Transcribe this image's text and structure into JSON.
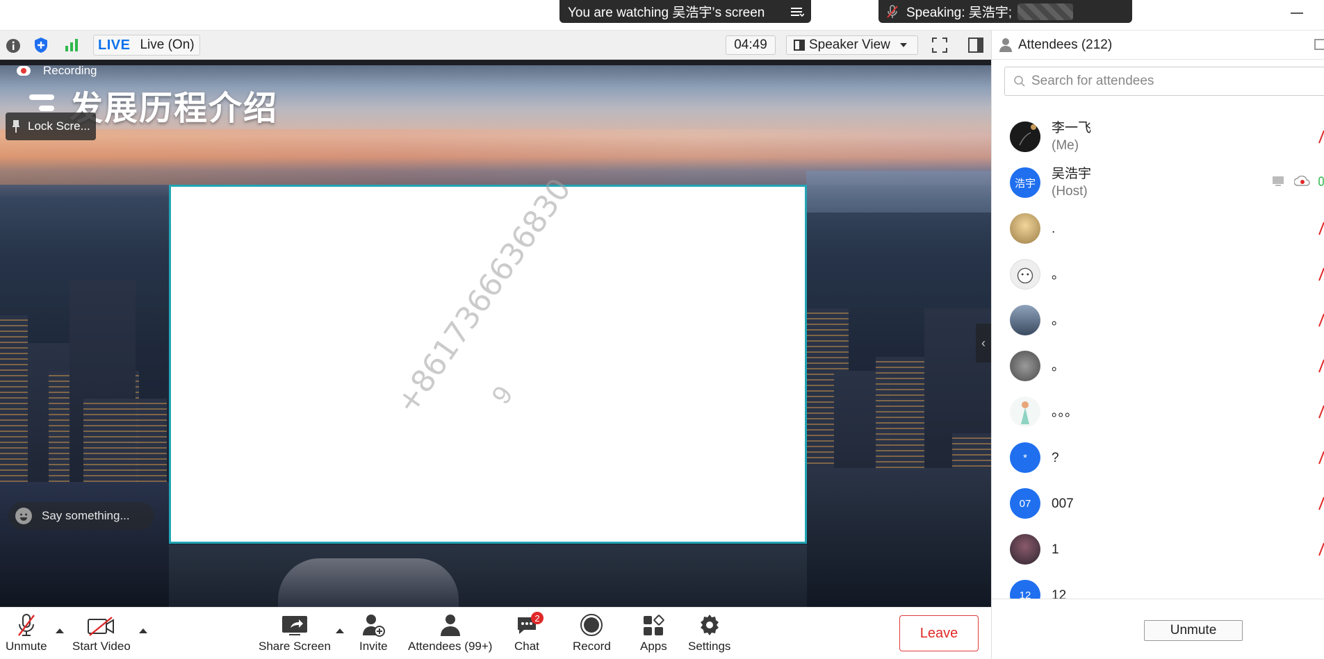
{
  "top": {
    "watching_text": "You are watching 吴浩宇’s screen",
    "speaking_text": "Speaking: 吴浩宇;"
  },
  "meeting": {
    "live_badge": "LIVE",
    "live_status": "Live (On)",
    "timer": "04:49",
    "view_mode": "Speaker View"
  },
  "stage": {
    "recording_label": "Recording",
    "headline": "发展历程介绍",
    "lock_screen_label": "Lock Scre...",
    "watermark": "+8617366636830",
    "watermark_prefix": "9",
    "say_placeholder": "Say something..."
  },
  "toolbar": {
    "unmute": "Unmute",
    "start_video": "Start Video",
    "share_screen": "Share Screen",
    "invite": "Invite",
    "attendees": "Attendees (99+)",
    "chat": "Chat",
    "chat_badge": "2",
    "record": "Record",
    "apps": "Apps",
    "settings": "Settings",
    "leave": "Leave"
  },
  "attendees_panel": {
    "title": "Attendees (212)",
    "search_placeholder": "Search for attendees",
    "unmute_button": "Unmute",
    "list": [
      {
        "name": "李一飞",
        "role": "(Me)",
        "avatar_text": "",
        "avatar_color": "#1a1a1a"
      },
      {
        "name": "吴浩宇",
        "role": "(Host)",
        "avatar_text": "浩宇",
        "avatar_color": "#1f6fef"
      },
      {
        "name": ".",
        "role": "",
        "avatar_text": "",
        "avatar_color": "#c9a96b"
      },
      {
        "name": "。",
        "role": "",
        "avatar_text": "",
        "avatar_color": "#e8e8e8"
      },
      {
        "name": "。",
        "role": "",
        "avatar_text": "",
        "avatar_color": "#5c6f86"
      },
      {
        "name": "。",
        "role": "",
        "avatar_text": "",
        "avatar_color": "#6f6f6f"
      },
      {
        "name": "。。。",
        "role": "",
        "avatar_text": "",
        "avatar_color": "#f3f7f5"
      },
      {
        "name": "?",
        "role": "",
        "avatar_text": "*",
        "avatar_color": "#1f6fef"
      },
      {
        "name": "007",
        "role": "",
        "avatar_text": "07",
        "avatar_color": "#1f6fef"
      },
      {
        "name": "1",
        "role": "",
        "avatar_text": "",
        "avatar_color": "#4a3a48"
      },
      {
        "name": "12",
        "role": "",
        "avatar_text": "12",
        "avatar_color": "#1f6fef"
      }
    ]
  },
  "colors": {
    "accent_blue": "#0e72ed",
    "leave_red": "#e02828",
    "share_border": "#22a5b5"
  }
}
